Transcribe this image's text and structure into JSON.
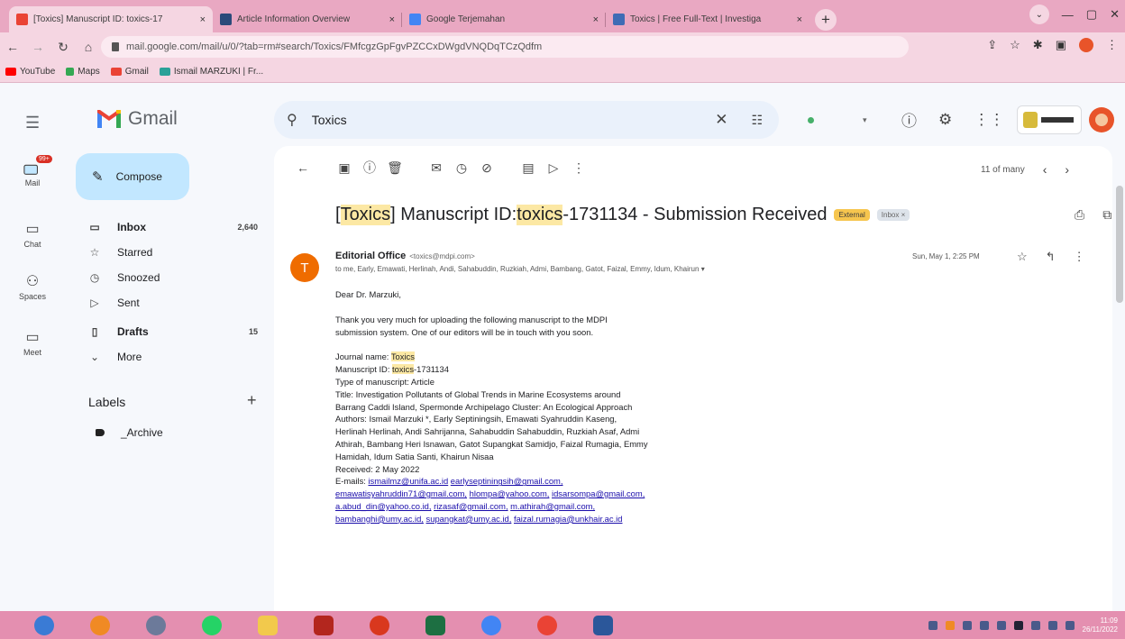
{
  "browser": {
    "tabs": [
      {
        "title": "[Toxics] Manuscript ID: toxics-17",
        "close": "×",
        "active": true
      },
      {
        "title": "Article Information Overview",
        "close": "×",
        "active": false
      },
      {
        "title": "Google Terjemahan",
        "close": "×",
        "active": false
      },
      {
        "title": "Toxics | Free Full-Text | Investiga",
        "close": "×",
        "active": false
      }
    ],
    "new_tab": "+",
    "url": "mail.google.com/mail/u/0/?tab=rm#search/Toxics/FMfcgzGpFgvPZCCxDWgdVNQDqTCzQdfm",
    "bookmarks": [
      "YouTube",
      "Maps",
      "Gmail",
      "Ismail MARZUKI | Fr..."
    ]
  },
  "gmail": {
    "app_name": "Gmail",
    "rail": [
      {
        "label": "Mail",
        "badge": "99+"
      },
      {
        "label": "Chat"
      },
      {
        "label": "Spaces"
      },
      {
        "label": "Meet"
      }
    ],
    "compose_label": "Compose",
    "nav": [
      {
        "label": "Inbox",
        "count": "2,640",
        "bold": true
      },
      {
        "label": "Starred",
        "count": ""
      },
      {
        "label": "Snoozed",
        "count": ""
      },
      {
        "label": "Sent",
        "count": ""
      },
      {
        "label": "Drafts",
        "count": "15",
        "bold": true
      },
      {
        "label": "More",
        "count": ""
      }
    ],
    "labels_heading": "Labels",
    "labels": [
      "_Archive"
    ],
    "search": {
      "query": "Toxics"
    },
    "pager_text": "11 of many",
    "subject": {
      "pre": "[",
      "hl1": "Toxics",
      "mid": "] Manuscript ID: ",
      "hl2": "toxics",
      "post": "-1731134 - Submission Received"
    },
    "badges": {
      "external": "External",
      "inbox": "Inbox ×"
    },
    "sender": {
      "initial": "T",
      "name": "Editorial Office",
      "email": "<toxics@mdpi.com>"
    },
    "recipients": "to me, Early, Emawati, Herlinah, Andi, Sahabuddin, Ruzkiah, Admi, Bambang, Gatot, Faizal, Emmy, Idum, Khairun",
    "date": "Sun, May 1, 2:25 PM",
    "body": {
      "greeting": "Dear Dr. Marzuki,",
      "intro": [
        "Thank you very much for uploading the following manuscript to the MDPI",
        "submission system. One of our editors will be in touch with you soon."
      ],
      "journal_label": "Journal name: ",
      "journal_value": "Toxics",
      "msid_label": "Manuscript ID: ",
      "msid_hl": "toxics",
      "msid_rest": "-1731134",
      "type": "Type of manuscript: Article",
      "title_lines": [
        "Title: Investigation Pollutants of Global Trends in Marine Ecosystems around",
        "Barrang Caddi Island, Spermonde Archipelago Cluster: An Ecological Approach"
      ],
      "authors_lines": [
        "Authors: Ismail Marzuki *, Early Septiningsih, Emawati Syahruddin Kaseng,",
        "Herlinah Herlinah, Andi Sahrijanna, Sahabuddin Sahabuddin, Ruzkiah Asaf, Admi",
        "Athirah, Bambang Heri Isnawan, Gatot Supangkat Samidjo, Faizal Rumagia, Emmy",
        "Hamidah, Idum Satia Santi, Khairun Nisaa"
      ],
      "received": "Received: 2 May 2022",
      "emails_label": "E-mails: ",
      "emails_lines": [
        [
          "ismailmz@unifa.ac.id",
          "earlyseptiningsih@gmail.com,"
        ],
        [
          "emawatisyahruddin71@gmail.com,",
          "hlompa@yahoo.com,",
          "idsarsompa@gmail.com,"
        ],
        [
          "a.abud_din@yahoo.co.id,",
          "rizasaf@gmail.com,",
          "m.athirah@gmail.com,"
        ],
        [
          "bambanghi@umy.ac.id,",
          "supangkat@umy.ac.id,",
          "faizal.rumagia@unkhair.ac.id"
        ]
      ]
    }
  },
  "taskbar": {
    "time": "11:09",
    "date": "26/11/2022"
  },
  "colors": {
    "chrome_frame": "#e9a8c2",
    "compose_bg": "#c2e7ff",
    "highlight": "#fce8a4",
    "sender_avatar": "#ef6c00",
    "taskbar": "#e48fb0"
  }
}
